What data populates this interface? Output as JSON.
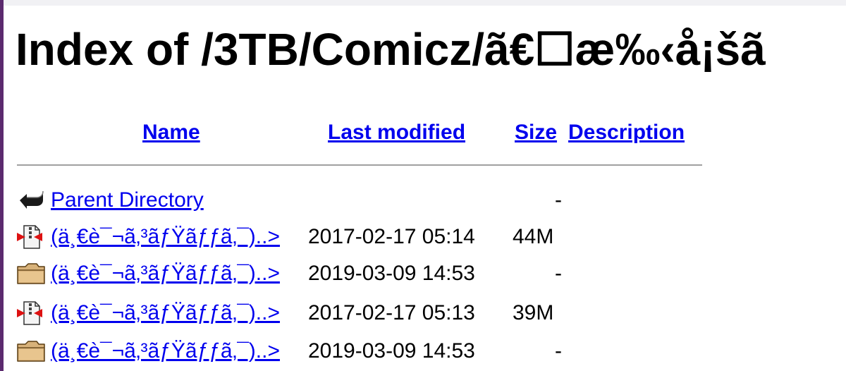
{
  "page": {
    "title": "Index of /3TB/Comicz/ã€☐æ‰‹å¡šã"
  },
  "columns": {
    "name": "Name",
    "last_modified": "Last modified",
    "size": "Size",
    "description": "Description"
  },
  "entries": [
    {
      "icon": "back-arrow-icon",
      "name": "Parent Directory",
      "date": "",
      "size": "-"
    },
    {
      "icon": "compressed-file-icon",
      "name": "(ä¸€è¯¬ã‚³ãƒŸãƒƒã‚¯)..>",
      "date": "2017-02-17 05:14",
      "size": "44M"
    },
    {
      "icon": "folder-icon",
      "name": "(ä¸€è¯¬ã‚³ãƒŸãƒƒã‚¯)..>",
      "date": "2019-03-09 14:53",
      "size": "-"
    },
    {
      "icon": "compressed-file-icon",
      "name": "(ä¸€è¯¬ã‚³ãƒŸãƒƒã‚¯)..>",
      "date": "2017-02-17 05:13",
      "size": "39M"
    },
    {
      "icon": "folder-icon",
      "name": "(ä¸€è¯¬ã‚³ãƒŸãƒƒã‚¯)..>",
      "date": "2019-03-09 14:53",
      "size": "-"
    }
  ]
}
